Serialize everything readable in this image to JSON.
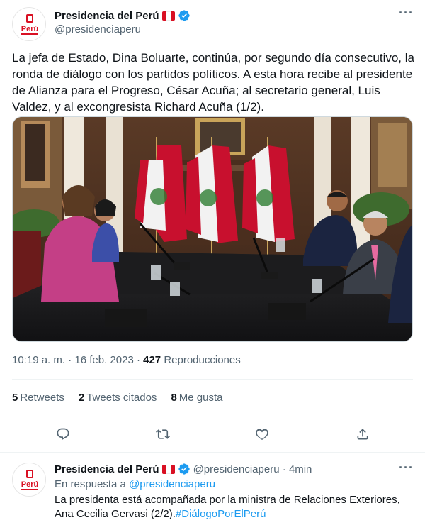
{
  "tweet": {
    "display_name": "Presidencia del Perú",
    "handle": "@presidenciaperu",
    "avatar_text": "Perú",
    "text": "La jefa de Estado, Dina Boluarte, continúa, por segundo día consecutivo, la ronda de diálogo con los partidos políticos. A esta hora recibe al presidente de Alianza para el Progreso, César Acuña; al secretario general, Luis Valdez, y al excongresista Richard Acuña (1/2).",
    "timestamp": "10:19 a. m. · 16 feb. 2023 · ",
    "views_count": "427",
    "views_label": " Reproducciones",
    "stats": {
      "retweets_count": "5",
      "retweets_label": "Retweets",
      "quotes_count": "2",
      "quotes_label": "Tweets citados",
      "likes_count": "8",
      "likes_label": "Me gusta"
    },
    "more_icon": "more-icon"
  },
  "reply": {
    "display_name": "Presidencia del Perú",
    "handle_time": "@presidenciaperu · 4min",
    "in_reply_prefix": "En respuesta a ",
    "in_reply_handle": "@presidenciaperu",
    "text": "La presidenta está acompañada por la ministra de Relaciones Exteriores, Ana Cecilia Gervasi (2/2).",
    "hashtag": "#DiálogoPorElPerú"
  },
  "colors": {
    "accent": "#1d9bf0",
    "secondary_text": "#536471",
    "flag_red": "#d91023"
  }
}
